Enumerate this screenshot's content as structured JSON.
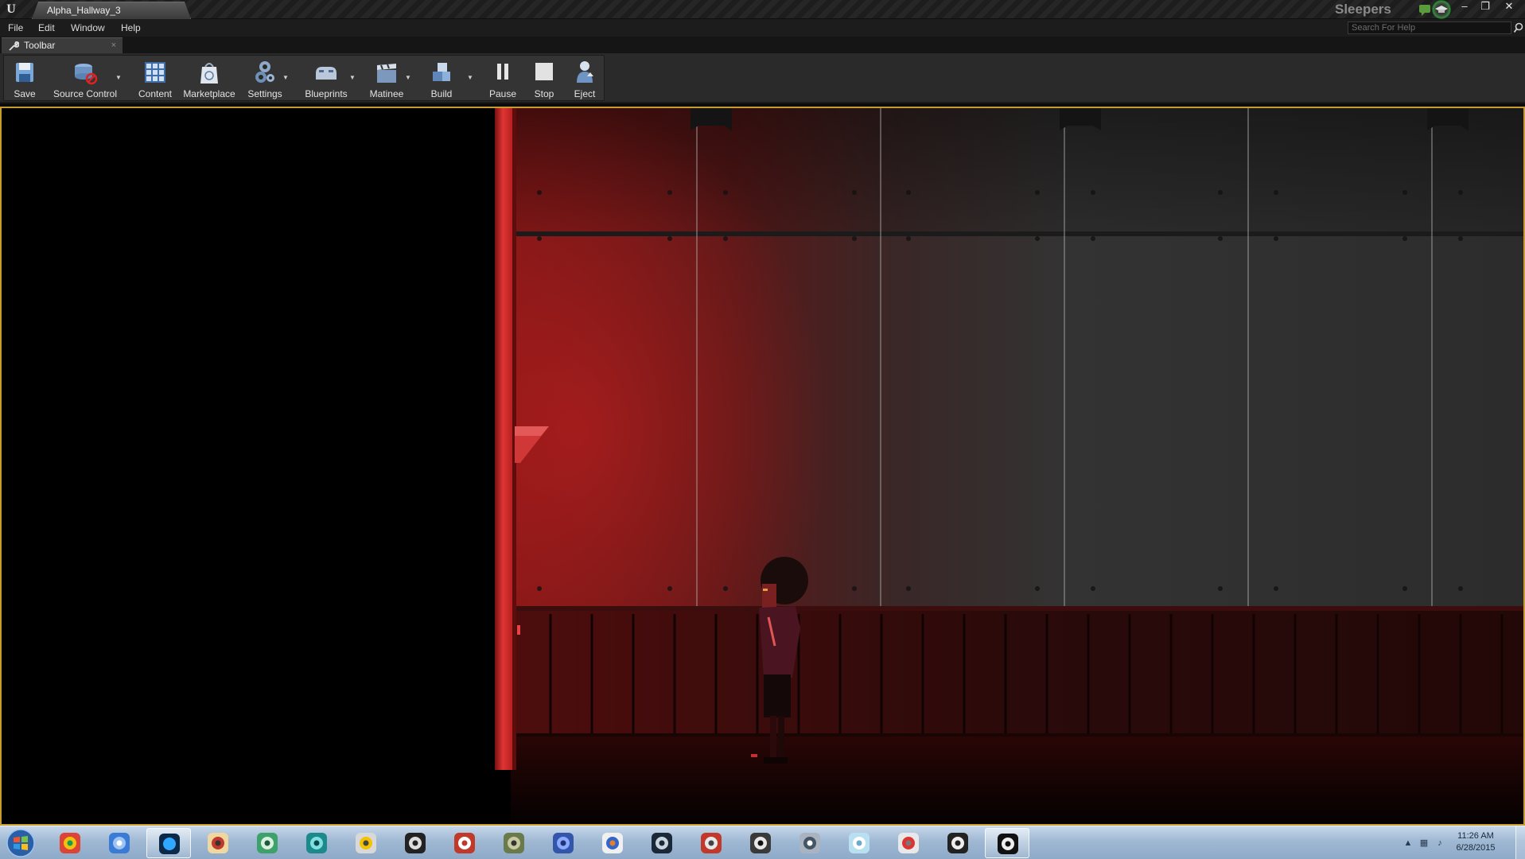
{
  "window": {
    "doc_tab_title": "Alpha_Hallway_3",
    "project_name": "Sleepers",
    "minimize": "–",
    "restore": "❐",
    "close": "✕"
  },
  "menu": {
    "items": [
      "File",
      "Edit",
      "Window",
      "Help"
    ],
    "search_placeholder": "Search For Help"
  },
  "toolbar_tab": {
    "label": "Toolbar",
    "close": "×"
  },
  "toolbar": {
    "save": "Save",
    "source_control": "Source Control",
    "content": "Content",
    "marketplace": "Marketplace",
    "settings": "Settings",
    "blueprints": "Blueprints",
    "matinee": "Matinee",
    "build": "Build",
    "pause": "Pause",
    "stop": "Stop",
    "eject": "Eject"
  },
  "taskbar": {
    "apps": [
      "start",
      "chrome",
      "itunes",
      "photoshop",
      "pencil-app",
      "gamemaker",
      "maya",
      "notepad-99",
      "epic-launcher",
      "substance",
      "halo",
      "infinity",
      "runner",
      "steam",
      "weapon-app",
      "guitar",
      "media-app",
      "glass-app",
      "rocket-app",
      "epic-games",
      "unreal-editor"
    ],
    "active_app": "unreal-editor",
    "time": "11:26 AM",
    "date": "6/28/2015"
  },
  "colors": {
    "accent_viewport_border": "#c79b2c",
    "wall_red": "#8e1a1a",
    "taskbar": "#9fb8d3"
  }
}
